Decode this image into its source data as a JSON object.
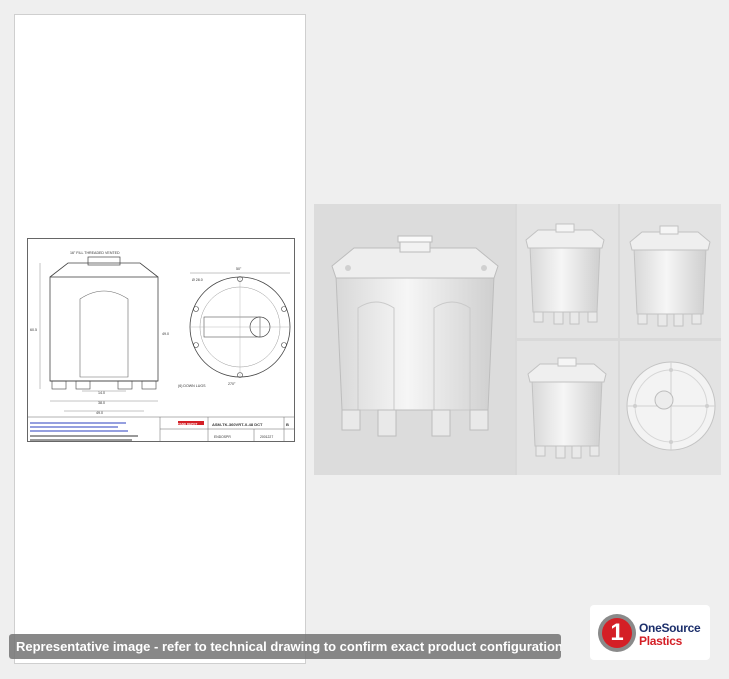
{
  "caption": "Representative image - refer to technical drawing to confirm exact product configuration.",
  "logo": {
    "badge_digit": "1",
    "line1": "OneSource",
    "line2": "Plastics",
    "colors": {
      "navy": "#1c2f6b",
      "red": "#d41f26"
    }
  },
  "drawing": {
    "title": "ASM-TK-360VRT-X-48 DCT",
    "company": "TANK DEPOT",
    "part_number": "ENDOSPR",
    "drawing_number": "2001227",
    "revision": "B",
    "callouts": {
      "fitting": "16\" FILL THREADED VENTED",
      "tiedown": "(6) DOWN LUGS",
      "angle": "270°"
    },
    "dimensions": {
      "height": "60.5",
      "inner_height": "49.0",
      "width_overall": "49.0",
      "width_base": "38.0",
      "leg_width": "14.0",
      "diameter": "50\"",
      "dia_small": "Ø 28.0"
    }
  },
  "photos": {
    "main": "tank-main-view",
    "views": [
      "tank-front-view",
      "tank-side-view",
      "tank-rear-view",
      "tank-top-view"
    ]
  }
}
